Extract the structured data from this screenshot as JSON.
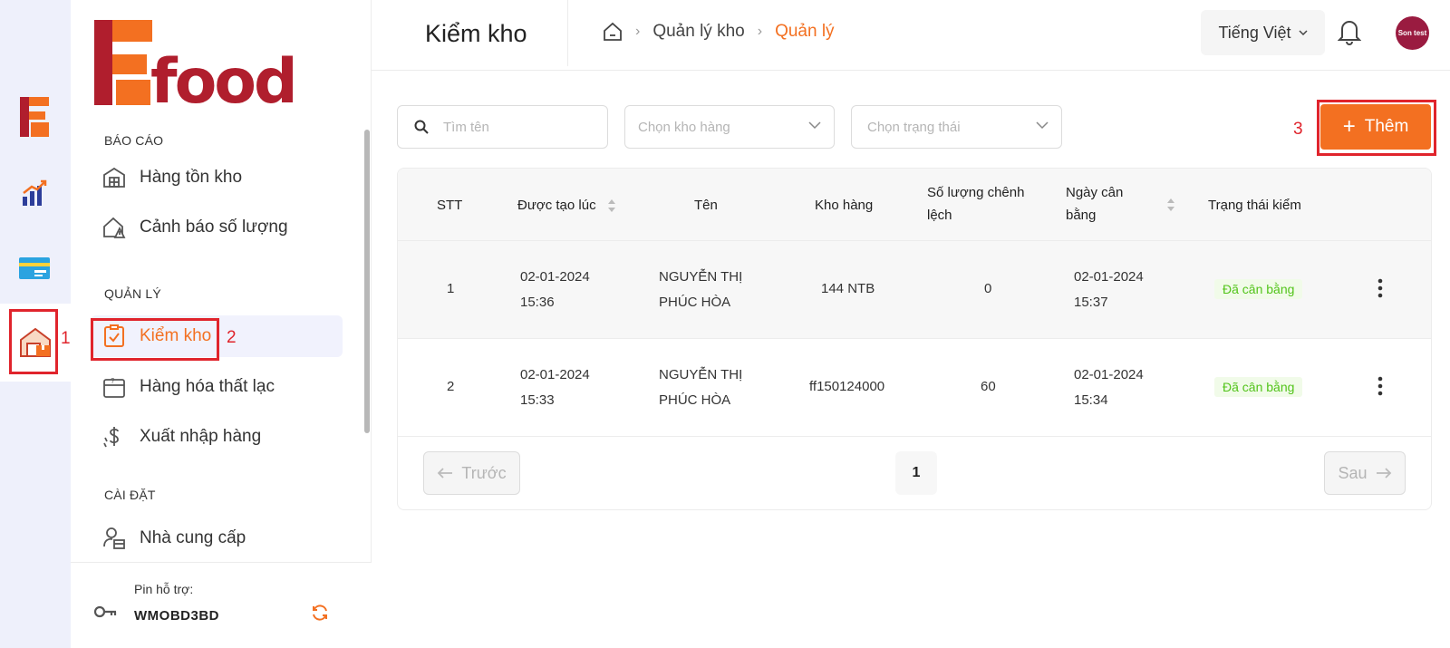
{
  "annotations": {
    "rail": "1",
    "nav": "2",
    "add": "3"
  },
  "brand": {
    "logo_text": "food",
    "logo_initial": "F",
    "primary": "#f37021",
    "dark_red": "#b01e2d"
  },
  "sidebar": {
    "sections": [
      {
        "title": "BÁO CÁO",
        "items": [
          {
            "label": "Hàng tồn kho",
            "icon": "warehouse-icon"
          },
          {
            "label": "Cảnh báo số lượng",
            "icon": "warning-house-icon"
          }
        ]
      },
      {
        "title": "QUẢN LÝ",
        "items": [
          {
            "label": "Kiểm kho",
            "icon": "clipboard-check-icon",
            "active": true
          },
          {
            "label": "Hàng hóa thất lạc",
            "icon": "lost-goods-icon"
          },
          {
            "label": "Xuất nhập hàng",
            "icon": "dollar-icon"
          }
        ]
      },
      {
        "title": "CÀI ĐẶT",
        "items": [
          {
            "label": "Nhà cung cấp",
            "icon": "supplier-icon"
          }
        ]
      }
    ],
    "footer": {
      "pin_label": "Pin hỗ trợ:",
      "pin_code": "WMOBD3BD"
    }
  },
  "header": {
    "title": "Kiểm kho",
    "breadcrumb": [
      "Quản lý kho",
      "Quản lý"
    ],
    "language": "Tiếng Việt",
    "avatar_text": "Son test"
  },
  "filters": {
    "search_placeholder": "Tìm tên",
    "warehouse_placeholder": "Chọn kho hàng",
    "status_placeholder": "Chọn trạng thái",
    "add_label": "Thêm"
  },
  "table": {
    "columns": {
      "stt": "STT",
      "created": "Được tạo lúc",
      "name": "Tên",
      "warehouse": "Kho hàng",
      "diff_1": "Số lượng chênh",
      "diff_2": "lệch",
      "balance_1": "Ngày cân",
      "balance_2": "bằng",
      "status": "Trạng thái kiểm"
    },
    "rows": [
      {
        "stt": "1",
        "created_date": "02-01-2024",
        "created_time": "15:36",
        "name_1": "NGUYỄN THỊ",
        "name_2": "PHÚC HÒA",
        "warehouse": "144 NTB",
        "diff": "0",
        "balance_date": "02-01-2024",
        "balance_time": "15:37",
        "status": "Đã cân bằng"
      },
      {
        "stt": "2",
        "created_date": "02-01-2024",
        "created_time": "15:33",
        "name_1": "NGUYỄN THỊ",
        "name_2": "PHÚC HÒA",
        "warehouse": "ff150124000",
        "diff": "60",
        "balance_date": "02-01-2024",
        "balance_time": "15:34",
        "status": "Đã cân bằng"
      }
    ]
  },
  "pagination": {
    "prev": "Trước",
    "next": "Sau",
    "current": "1"
  }
}
